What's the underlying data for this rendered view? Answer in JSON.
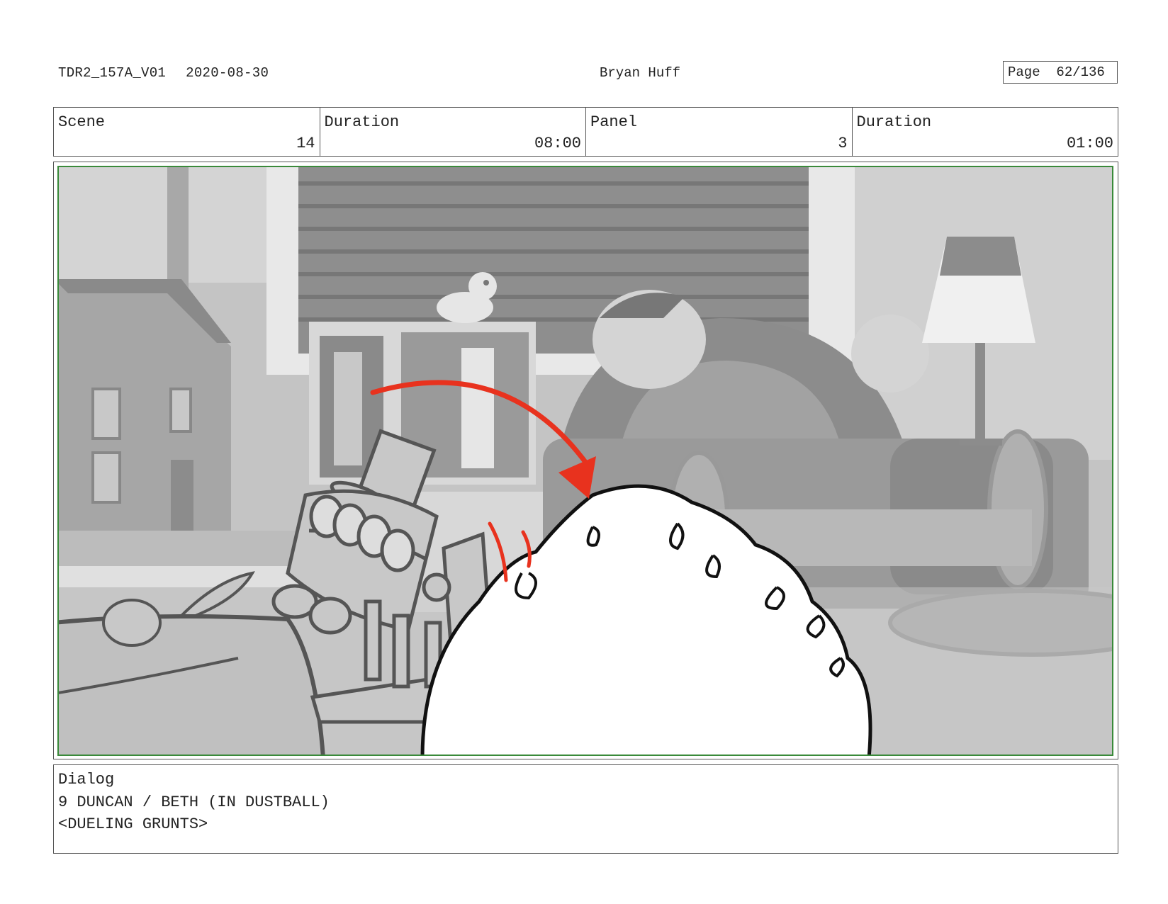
{
  "header": {
    "file_id": "TDR2_157A_V01",
    "date": "2020-08-30",
    "author": "Bryan Huff",
    "page_label": "Page",
    "page_value": "62/136"
  },
  "info": {
    "scene_label": "Scene",
    "scene_value": "14",
    "scene_duration_label": "Duration",
    "scene_duration_value": "08:00",
    "panel_label": "Panel",
    "panel_value": "3",
    "panel_duration_label": "Duration",
    "panel_duration_value": "01:00"
  },
  "dialog": {
    "label": "Dialog",
    "line1": "9 DUNCAN / BETH (IN DUSTBALL)",
    "line2": "<DUELING GRUNTS>"
  },
  "colors": {
    "safe_frame": "#3a8a3a",
    "arrow": "#e8321e",
    "background_gray": "#bdbdbd"
  }
}
